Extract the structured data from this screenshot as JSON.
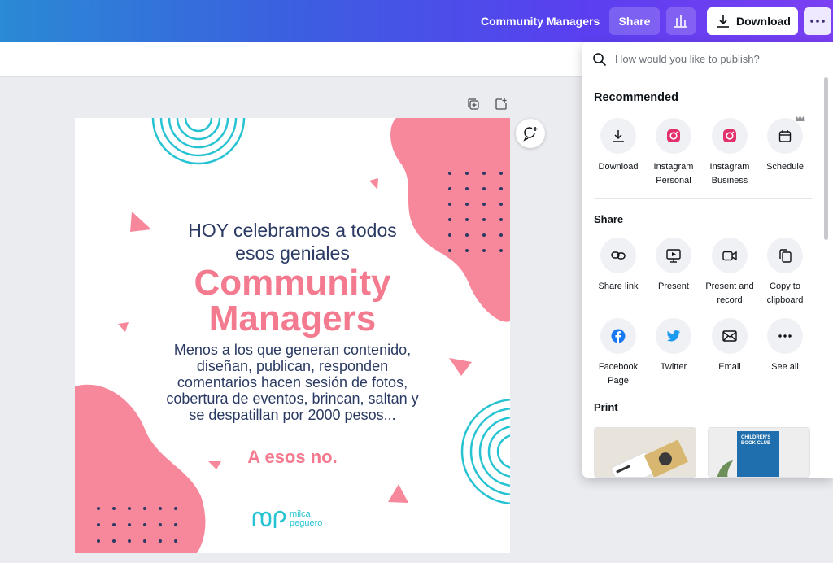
{
  "header": {
    "doc_title": "Community Managers",
    "share_label": "Share",
    "download_label": "Download",
    "more_label": "More"
  },
  "publish": {
    "search_placeholder": "How would you like to publish?",
    "recommended_title": "Recommended",
    "recommended": [
      {
        "label": "Download",
        "icon": "download-icon"
      },
      {
        "label": "Instagram Personal",
        "icon": "instagram-icon"
      },
      {
        "label": "Instagram Business",
        "icon": "instagram-icon"
      },
      {
        "label": "Schedule",
        "icon": "calendar-icon"
      }
    ],
    "share_title": "Share",
    "share": [
      {
        "label": "Share link",
        "icon": "link-icon"
      },
      {
        "label": "Present",
        "icon": "present-icon"
      },
      {
        "label": "Present and record",
        "icon": "video-icon"
      },
      {
        "label": "Copy to clipboard",
        "icon": "copy-icon"
      },
      {
        "label": "Facebook Page",
        "icon": "facebook-icon"
      },
      {
        "label": "Twitter",
        "icon": "twitter-icon"
      },
      {
        "label": "Email",
        "icon": "email-icon"
      },
      {
        "label": "See all",
        "icon": "more-icon"
      }
    ],
    "print_title": "Print",
    "print_items": [
      {
        "title": ""
      },
      {
        "title": "CHILDREN'S BOOK CLUB"
      }
    ]
  },
  "design": {
    "line1": "HOY celebramos a todos",
    "line2": "esos geniales",
    "big1": "Community",
    "big2": "Managers",
    "body": "Menos a los que generan contenido, diseñan, publican, responden comentarios hacen sesión de fotos, cobertura de eventos, brincan, saltan y se despatillan por 2000 pesos...",
    "cta": "A esos no.",
    "logo_line1": "milca",
    "logo_line2": "peguero",
    "colors": {
      "pink": "#f37a8f",
      "navy": "#2a3a63",
      "teal": "#27c3d3"
    }
  }
}
